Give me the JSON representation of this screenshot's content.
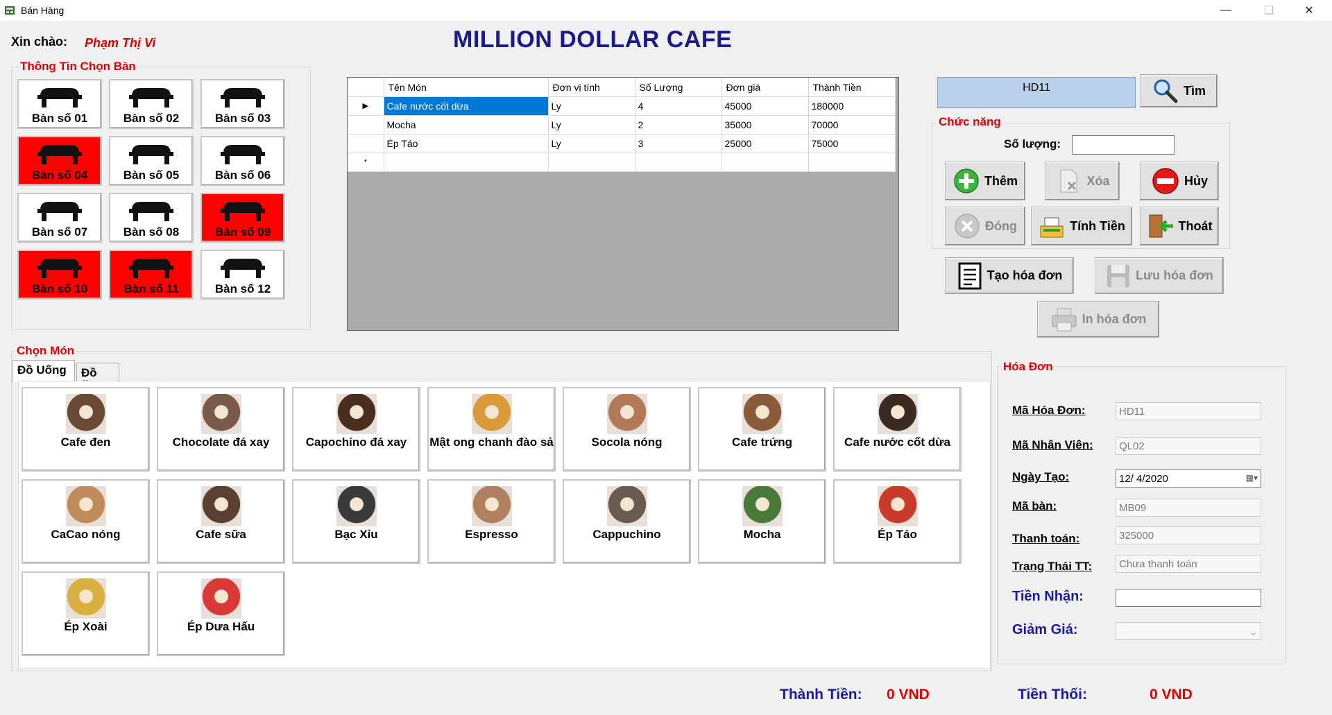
{
  "window": {
    "title": "Bán Hàng"
  },
  "header": {
    "greeting": "Xin chào:",
    "user": "Phạm Thị Vi",
    "brand": "MILLION DOLLAR CAFE"
  },
  "tables": {
    "legend": "Thông Tin Chọn Bàn",
    "items": [
      {
        "label": "Bàn số 01",
        "busy": false
      },
      {
        "label": "Bàn số 02",
        "busy": false
      },
      {
        "label": "Bàn số 03",
        "busy": false
      },
      {
        "label": "Bàn số 04",
        "busy": true
      },
      {
        "label": "Bàn số 05",
        "busy": false
      },
      {
        "label": "Bàn số 06",
        "busy": false
      },
      {
        "label": "Bàn số 07",
        "busy": false
      },
      {
        "label": "Bàn số 08",
        "busy": false
      },
      {
        "label": "Bàn số 09",
        "busy": true
      },
      {
        "label": "Bàn số 10",
        "busy": true
      },
      {
        "label": "Bàn số 11",
        "busy": true
      },
      {
        "label": "Bàn số 12",
        "busy": false
      }
    ],
    "busy_color": "#ff0000"
  },
  "grid": {
    "columns": [
      "Tên Món",
      "Đơn vị tính",
      "Số Lượng",
      "Đơn giá",
      "Thành Tiền"
    ],
    "rows": [
      [
        "Cafe nước cốt dừa",
        "Ly",
        "4",
        "45000",
        "180000"
      ],
      [
        "Mocha",
        "Ly",
        "2",
        "35000",
        "70000"
      ],
      [
        "Ép Táo",
        "Ly",
        "3",
        "25000",
        "75000"
      ]
    ],
    "current_row_marker": "▶",
    "new_row_marker": "*"
  },
  "search": {
    "value": "HD11",
    "button": "Tìm"
  },
  "functions": {
    "legend": "Chức năng",
    "quantity_label": "Số lượng:",
    "quantity_value": "",
    "add": "Thêm",
    "delete": "Xóa",
    "cancel": "Hủy",
    "close": "Đóng",
    "calculate": "Tính Tiền",
    "exit": "Thoát",
    "create_invoice": "Tạo hóa đơn",
    "save_invoice": "Lưu hóa đơn",
    "print_invoice": "In hóa đơn"
  },
  "menu": {
    "legend": "Chọn Món",
    "tabs": [
      "Đồ Uống",
      "Đồ Ăn"
    ],
    "items": [
      {
        "name": "Cafe đen",
        "color": "#6b4a34"
      },
      {
        "name": "Chocolate đá xay",
        "color": "#7a5a48"
      },
      {
        "name": "Capochino đá xay",
        "color": "#4a2e1c"
      },
      {
        "name": "Mật ong chanh đào sả",
        "color": "#d89a3a"
      },
      {
        "name": "Socola nóng",
        "color": "#b07a5a"
      },
      {
        "name": "Cafe trứng",
        "color": "#8a5a3a"
      },
      {
        "name": "Cafe nước cốt dừa",
        "color": "#3a2a22"
      },
      {
        "name": "CaCao nóng",
        "color": "#c08a5a"
      },
      {
        "name": "Cafe sữa",
        "color": "#5a4030"
      },
      {
        "name": "Bạc Xỉu",
        "color": "#3a3a3a"
      },
      {
        "name": "Espresso",
        "color": "#b08060"
      },
      {
        "name": "Cappuchino",
        "color": "#6a5a50"
      },
      {
        "name": "Mocha",
        "color": "#4a7a3a"
      },
      {
        "name": "Ép Táo",
        "color": "#c83a2a"
      },
      {
        "name": "Ép Xoài",
        "color": "#d8b040"
      },
      {
        "name": "Ép Dưa Hấu",
        "color": "#d83a3a"
      }
    ]
  },
  "invoice": {
    "legend": "Hóa Đơn",
    "invoice_id_label": "Mã Hóa Đơn:",
    "invoice_id": "HD11",
    "staff_id_label": "Mã Nhân Viên:",
    "staff_id": "QL02",
    "date_label": "Ngày Tạo:",
    "date": "12/  4/2020",
    "table_id_label": "Mã bàn:",
    "table_id": "MB09",
    "payment_label": "Thanh toán:",
    "payment": "325000",
    "status_label": "Trạng Thái TT:",
    "status": "Chưa thanh toán",
    "received_label": "Tiền Nhận:",
    "received": "",
    "discount_label": "Giảm Giá:",
    "discount": ""
  },
  "totals": {
    "total_label": "Thành Tiền:",
    "total": "0 VND",
    "change_label": "Tiền Thối:",
    "change": "0 VND"
  }
}
